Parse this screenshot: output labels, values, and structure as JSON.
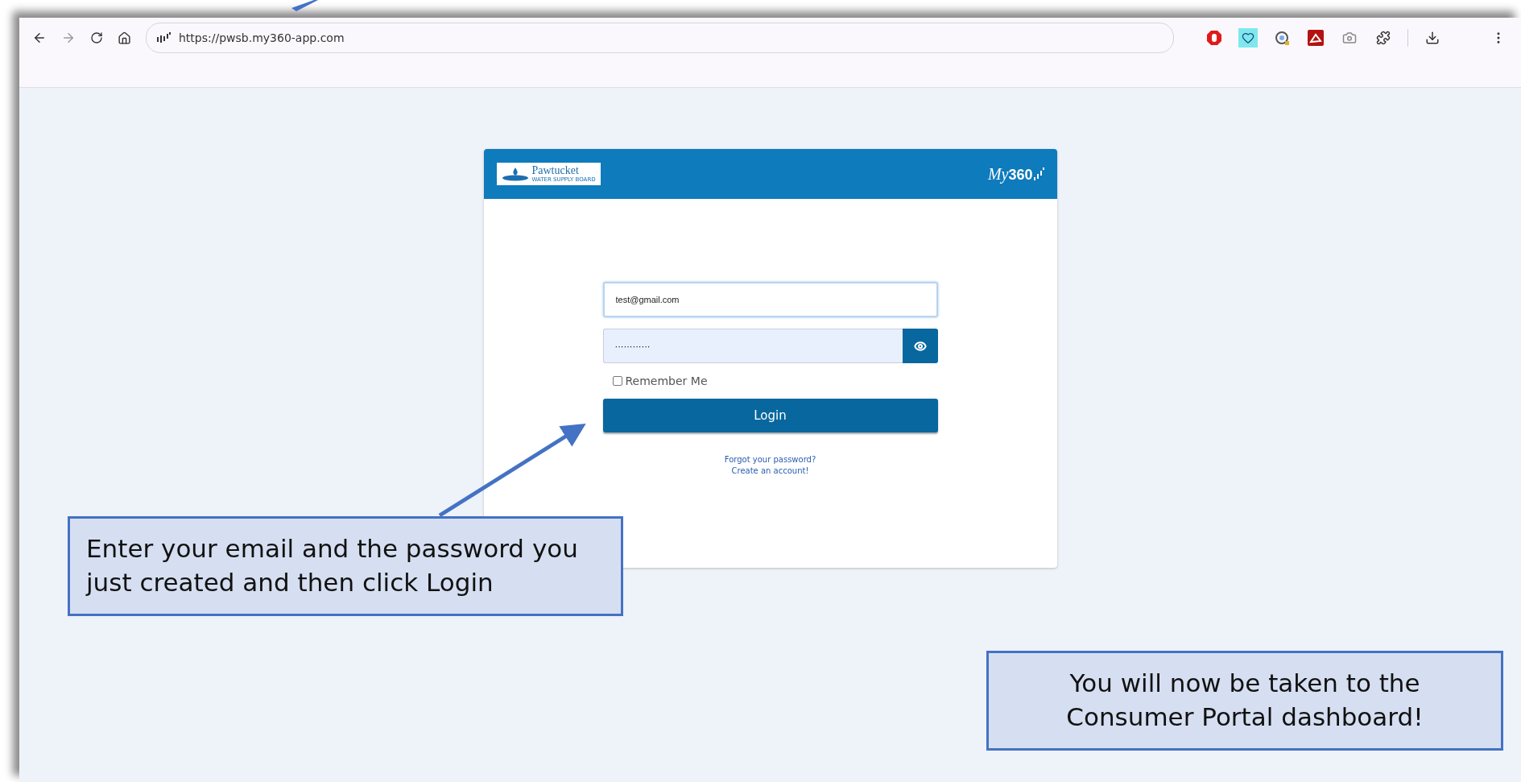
{
  "browser": {
    "url": "https://pwsb.my360-app.com"
  },
  "card": {
    "logo": {
      "name": "Pawtucket",
      "subtitle": "WATER SUPPLY BOARD"
    },
    "brand": {
      "prefix": "My",
      "number": "360"
    },
    "email": {
      "value": "test@gmail.com",
      "focused": true
    },
    "password": {
      "value": "············"
    },
    "remember": {
      "label": "Remember Me",
      "checked": false
    },
    "login": "Login",
    "links": [
      "Forgot your password?",
      "Create an account!"
    ]
  },
  "callouts": [
    {
      "text": "Enter your email and the password you just created and then click Login"
    },
    {
      "text": "You will now be taken to the Consumer Portal dashboard!"
    }
  ]
}
